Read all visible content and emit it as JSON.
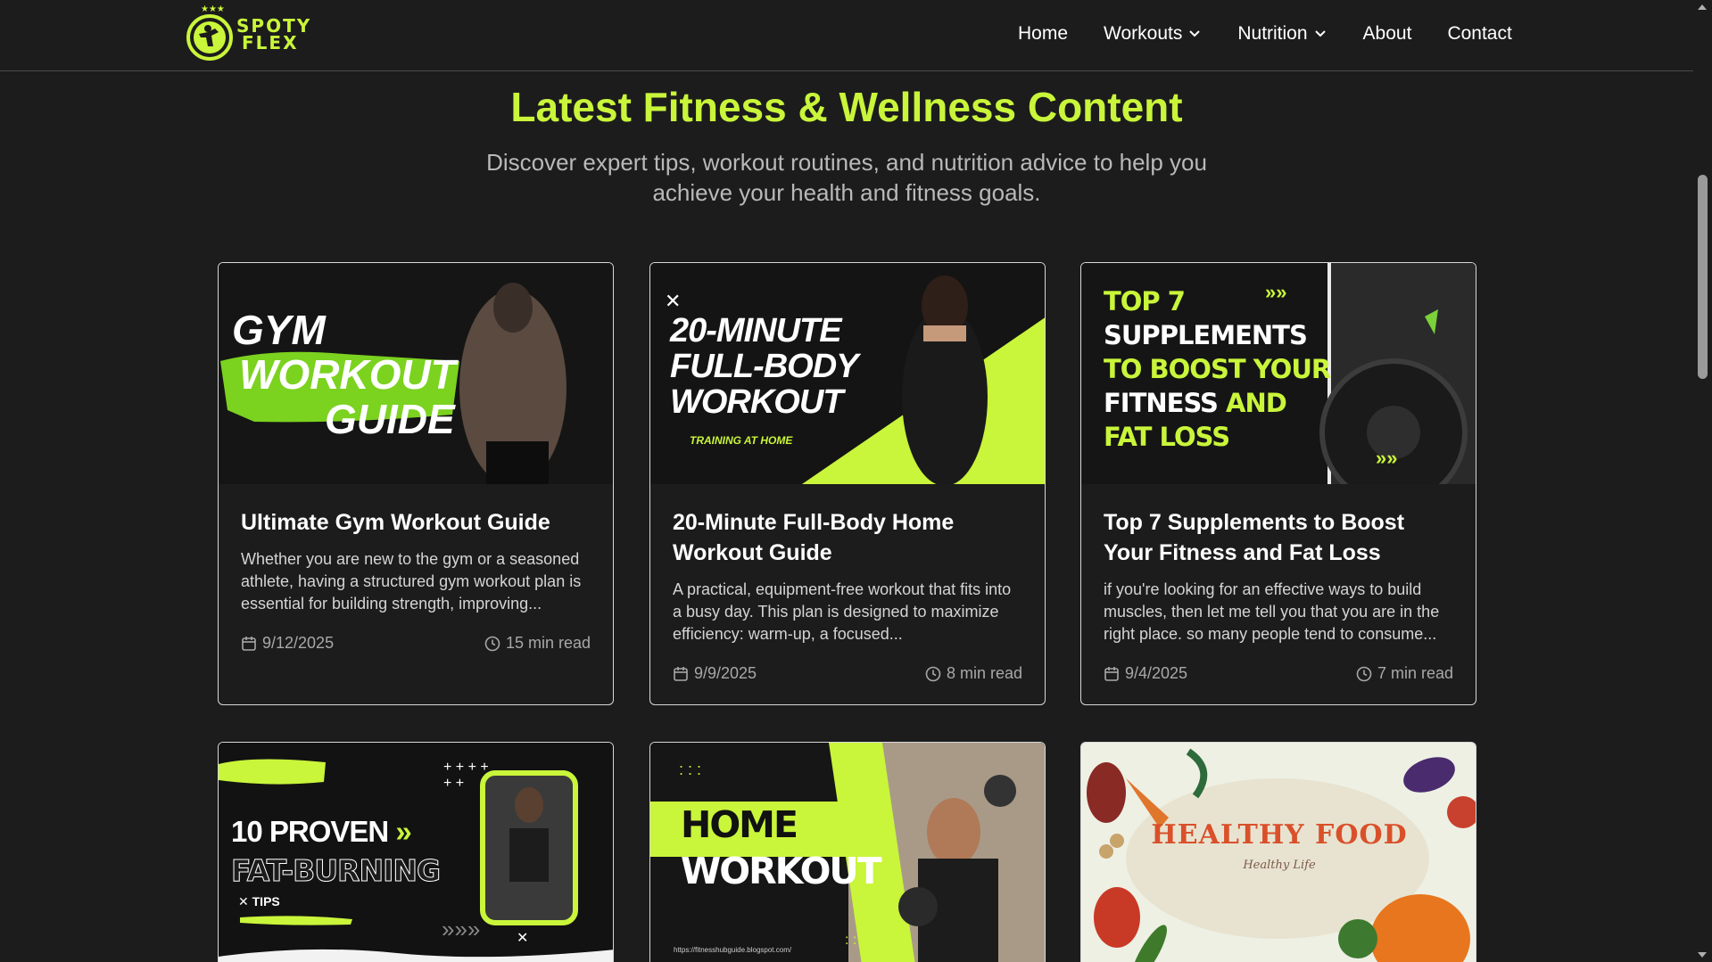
{
  "brand": {
    "line1": "SPOTY",
    "line2": "FLEX"
  },
  "nav": {
    "home": "Home",
    "workouts": "Workouts",
    "nutrition": "Nutrition",
    "about": "About",
    "contact": "Contact"
  },
  "hero": {
    "title": "Latest Fitness & Wellness Content",
    "subtitle": "Discover expert tips, workout routines, and nutrition advice to help you achieve your health and fitness goals."
  },
  "posts": [
    {
      "title": "Ultimate Gym Workout Guide",
      "excerpt": "Whether you are new to the gym or a seasoned athlete, having a structured gym workout plan is essential for building strength, improving...",
      "date": "9/12/2025",
      "read": "15 min read",
      "img": {
        "line1": "GYM",
        "line2": "WORKOUT",
        "line3": "GUIDE"
      }
    },
    {
      "title": "20-Minute Full-Body Home Workout Guide",
      "excerpt": "A practical, equipment-free workout that fits into a busy day. This plan is designed to maximize efficiency: warm-up, a focused...",
      "date": "9/9/2025",
      "read": "8 min read",
      "img": {
        "line1": "20-MINUTE",
        "line2": "FULL-BODY",
        "line3": "WORKOUT",
        "tag": "TRAINING AT HOME"
      }
    },
    {
      "title": "Top 7 Supplements to Boost Your Fitness and Fat Loss",
      "excerpt": "if you're looking for an effective ways to build muscles, then let me tell you that you are in the right place. so many people tend to consume...",
      "date": "9/4/2025",
      "read": "7 min read",
      "img": {
        "line1": "TOP 7",
        "line2": "SUPPLEMENTS",
        "line3": "TO BOOST YOUR",
        "line4a": "FITNESS",
        "line4b": "AND",
        "line5": "FAT LOSS"
      }
    },
    {
      "img": {
        "line1": "10 PROVEN",
        "line2": "FAT-BURNING",
        "tag": "TIPS"
      }
    },
    {
      "img": {
        "line1": "HOME",
        "line2": "WORKOUT",
        "url": "https://fitnesshubguide.blogspot.com/"
      }
    },
    {
      "img": {
        "line1": "HEALTHY FOOD",
        "line2": "Healthy Life"
      }
    }
  ],
  "colors": {
    "accent": "#c9f53a",
    "background": "#1c1c1c",
    "border": "#d8d8d8"
  },
  "icons": [
    "calendar-icon",
    "clock-icon",
    "chevron-down-icon",
    "logo-icon"
  ]
}
